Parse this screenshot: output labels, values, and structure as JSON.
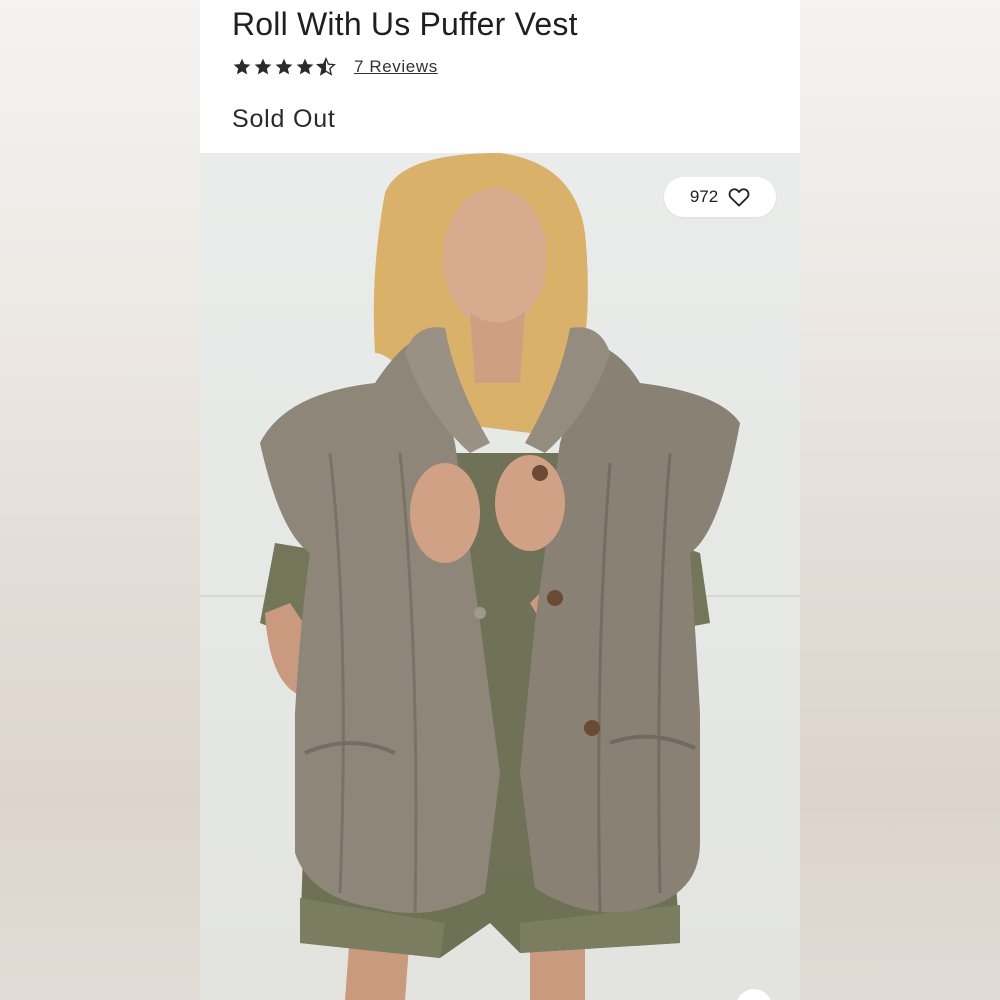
{
  "product": {
    "title": "Roll With Us Puffer Vest",
    "rating": 4.5,
    "rating_max": 5,
    "reviews_label": "7 Reviews",
    "availability": "Sold Out"
  },
  "photo": {
    "like_count": "972",
    "like_icon": "heart-outline-icon"
  },
  "colors": {
    "text": "#1f1f1f",
    "star": "#2b2b2b",
    "vest": "#8f867a",
    "shirt": "#6f7256"
  }
}
